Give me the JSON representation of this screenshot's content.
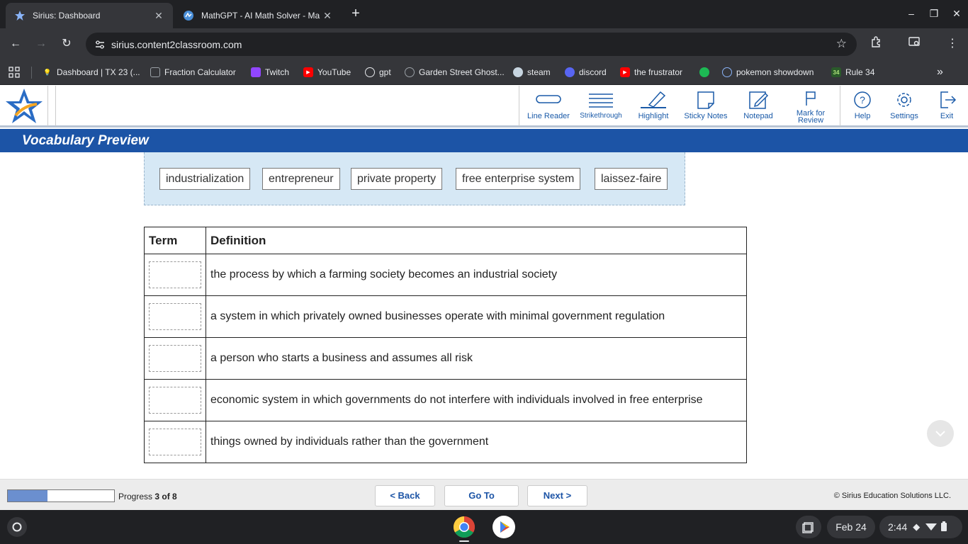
{
  "browser": {
    "tabs": [
      {
        "title": "Sirius: Dashboard",
        "active": true
      },
      {
        "title": "MathGPT - AI Math Solver - Ma",
        "active": false
      }
    ],
    "new_tab_symbol": "+",
    "window_controls": {
      "minimize": "–",
      "maximize": "❐",
      "close": "✕"
    },
    "nav": {
      "back": "←",
      "forward": "→",
      "reload": "↻"
    },
    "url": "sirius.content2classroom.com",
    "bookmarks": [
      {
        "label": "Dashboard | TX 23 (...",
        "icon": "bulb-icon",
        "color": "#f4a742"
      },
      {
        "label": "Fraction Calculator",
        "icon": "calculator-icon",
        "color": "#9aa0a6"
      },
      {
        "label": "Twitch",
        "icon": "twitch-icon",
        "color": "#9146ff"
      },
      {
        "label": "YouTube",
        "icon": "youtube-icon",
        "color": "#ff0000"
      },
      {
        "label": "gpt",
        "icon": "openai-icon",
        "color": "#e8eaed"
      },
      {
        "label": "Garden Street Ghost...",
        "icon": "globe-icon",
        "color": "#9aa0a6"
      },
      {
        "label": "steam",
        "icon": "steam-icon",
        "color": "#1b2838"
      },
      {
        "label": "discord",
        "icon": "discord-icon",
        "color": "#5865f2"
      },
      {
        "label": "the frustrator",
        "icon": "youtube-icon",
        "color": "#ff0000"
      },
      {
        "label": "",
        "icon": "spotify-icon",
        "color": "#1db954"
      },
      {
        "label": "pokemon showdown",
        "icon": "pokemon-icon",
        "color": "#4a90d9"
      },
      {
        "label": "Rule 34",
        "icon": "r34-icon",
        "color": "#2a5a2a"
      }
    ],
    "bookmarks_overflow": "»"
  },
  "app": {
    "tools": [
      {
        "label": "Line Reader",
        "icon": "line-reader-icon"
      },
      {
        "label": "Strikethrough",
        "icon": "strikethrough-icon"
      },
      {
        "label": "Highlight",
        "icon": "highlight-icon"
      },
      {
        "label": "Sticky Notes",
        "icon": "sticky-notes-icon"
      },
      {
        "label": "Notepad",
        "icon": "notepad-icon"
      },
      {
        "label": "Mark for Review",
        "icon": "flag-icon"
      },
      {
        "label": "Help",
        "icon": "help-icon"
      },
      {
        "label": "Settings",
        "icon": "settings-icon"
      },
      {
        "label": "Exit",
        "icon": "exit-icon"
      }
    ],
    "section_title": "Vocabulary Preview",
    "word_bank": [
      "industrialization",
      "entrepreneur",
      "private property",
      "free enterprise system",
      "laissez-faire"
    ],
    "table": {
      "headers": [
        "Term",
        "Definition"
      ],
      "rows": [
        "the process by which a farming society becomes an industrial society",
        "a system in which privately owned businesses operate with minimal government regulation",
        "a person who starts a business and assumes all risk",
        "economic system in which governments do not interfere with individuals involved in free enterprise",
        "things owned by individuals rather than the government"
      ]
    },
    "footer": {
      "progress_label": "Progress",
      "progress_value": "3 of 8",
      "progress_fraction": 0.375,
      "back": "< Back",
      "goto": "Go To",
      "next": "Next >",
      "copyright": "© Sirius Education Solutions LLC."
    },
    "colors": {
      "brand_blue": "#1c54a6",
      "tool_blue": "#1a5aa8",
      "progress_fill": "#6b8fcf"
    }
  },
  "shelf": {
    "date": "Feb 24",
    "time": "2:44",
    "apps": [
      "chrome-icon",
      "play-store-icon"
    ]
  }
}
